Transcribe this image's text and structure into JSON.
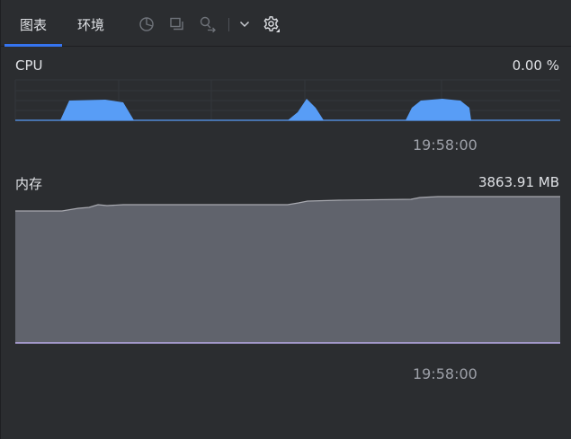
{
  "tabs": [
    {
      "label": "图表",
      "active": true
    },
    {
      "label": "环境",
      "active": false
    }
  ],
  "toolbar": {
    "icons": [
      "pie-chart-icon",
      "copy-icon",
      "key-search-icon",
      "chevron-down-icon",
      "gear-icon"
    ]
  },
  "cpu": {
    "label": "CPU",
    "value": "0.00 %",
    "time_label": "19:58:00",
    "color": "#589df6"
  },
  "memory": {
    "label": "内存",
    "value": "3863.91 MB",
    "time_label": "19:58:00",
    "fill_color": "#60636c",
    "line_color": "#a8a9b0"
  }
}
